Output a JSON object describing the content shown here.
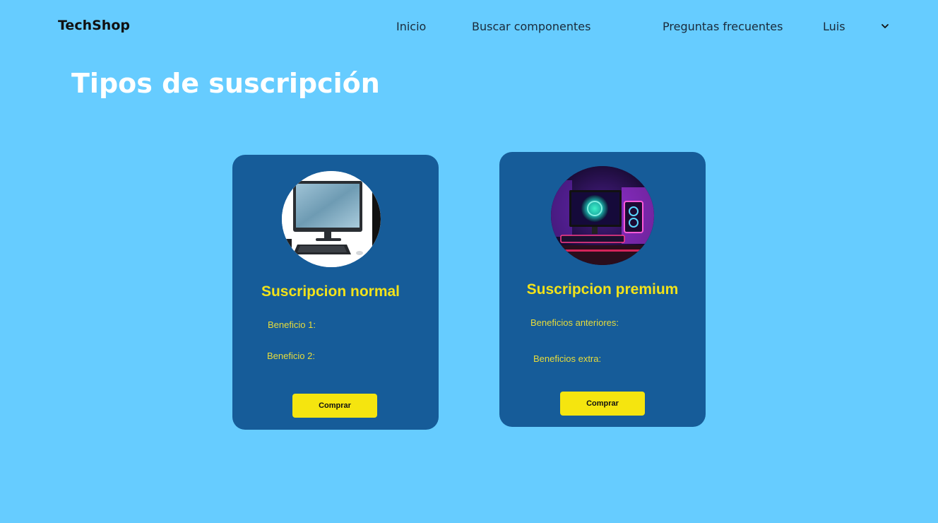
{
  "header": {
    "brand": "TechShop",
    "nav": {
      "home": "Inicio",
      "search": "Buscar componentes",
      "faq": "Preguntas frecuentes",
      "user": "Luis"
    },
    "user_menu_icon": "chevron-down-icon"
  },
  "main": {
    "title": "Tipos de suscripción",
    "plans": [
      {
        "title": "Suscripcion normal",
        "benefits": [
          "Beneficio 1:",
          "Beneficio 2:"
        ],
        "button": "Comprar",
        "image": "office-desktop-computer"
      },
      {
        "title": "Suscripcion premium",
        "benefits": [
          "Beneficios anteriores:",
          "Beneficios extra:"
        ],
        "button": "Comprar",
        "image": "gaming-setup-rgb"
      }
    ]
  },
  "colors": {
    "background": "#66CCFF",
    "card": "#165C99",
    "accent_yellow": "#F5E50F",
    "title_white": "#FFFFFF"
  }
}
